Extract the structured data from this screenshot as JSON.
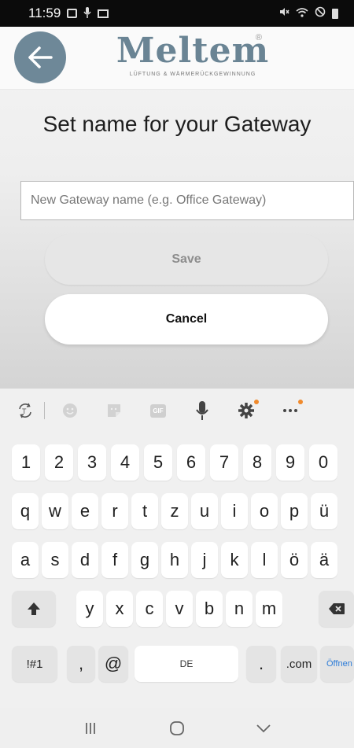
{
  "status_bar": {
    "time": "11:59",
    "icons_left": [
      "image-icon",
      "microphone-icon",
      "mail-icon"
    ],
    "icons_right": [
      "mute-icon",
      "wifi-icon",
      "no-disturb-icon",
      "battery-icon"
    ]
  },
  "header": {
    "logo_text": "Meltem",
    "logo_tagline": "LÜFTUNG & WÄRMERÜCKGEWINNUNG",
    "logo_registered": "®",
    "back_icon": "arrow-left-icon",
    "back_button_color": "#6e8898"
  },
  "main": {
    "title": "Set name for your Gateway",
    "name_input": {
      "value": "",
      "placeholder": "New Gateway name (e.g. Office Gateway)"
    },
    "save_label": "Save",
    "cancel_label": "Cancel"
  },
  "keyboard": {
    "toolbar": [
      "translate-icon",
      "emoji-icon",
      "sticker-icon",
      "gif-icon",
      "microphone-icon",
      "settings-icon",
      "more-icon"
    ],
    "gif_label": "GIF",
    "rows": [
      [
        "1",
        "2",
        "3",
        "4",
        "5",
        "6",
        "7",
        "8",
        "9",
        "0"
      ],
      [
        "q",
        "w",
        "e",
        "r",
        "t",
        "z",
        "u",
        "i",
        "o",
        "p",
        "ü"
      ],
      [
        "a",
        "s",
        "d",
        "f",
        "g",
        "h",
        "j",
        "k",
        "l",
        "ö",
        "ä"
      ],
      [
        "y",
        "x",
        "c",
        "v",
        "b",
        "n",
        "m"
      ]
    ],
    "shift_icon": "shift-arrow-icon",
    "backspace_icon": "backspace-icon",
    "symbols_label": "!#1",
    "comma_label": ",",
    "at_label": "@",
    "space_label": "DE",
    "period_label": ".",
    "dotcom_label": ".com",
    "open_label": "Öffnen"
  },
  "nav_bar": {
    "items": [
      "recent-apps-icon",
      "home-icon",
      "back-chevron-icon"
    ]
  },
  "colors": {
    "accent": "#6e8898",
    "open_key_text": "#2b7bd8",
    "notification_dot": "#f08a2c"
  }
}
